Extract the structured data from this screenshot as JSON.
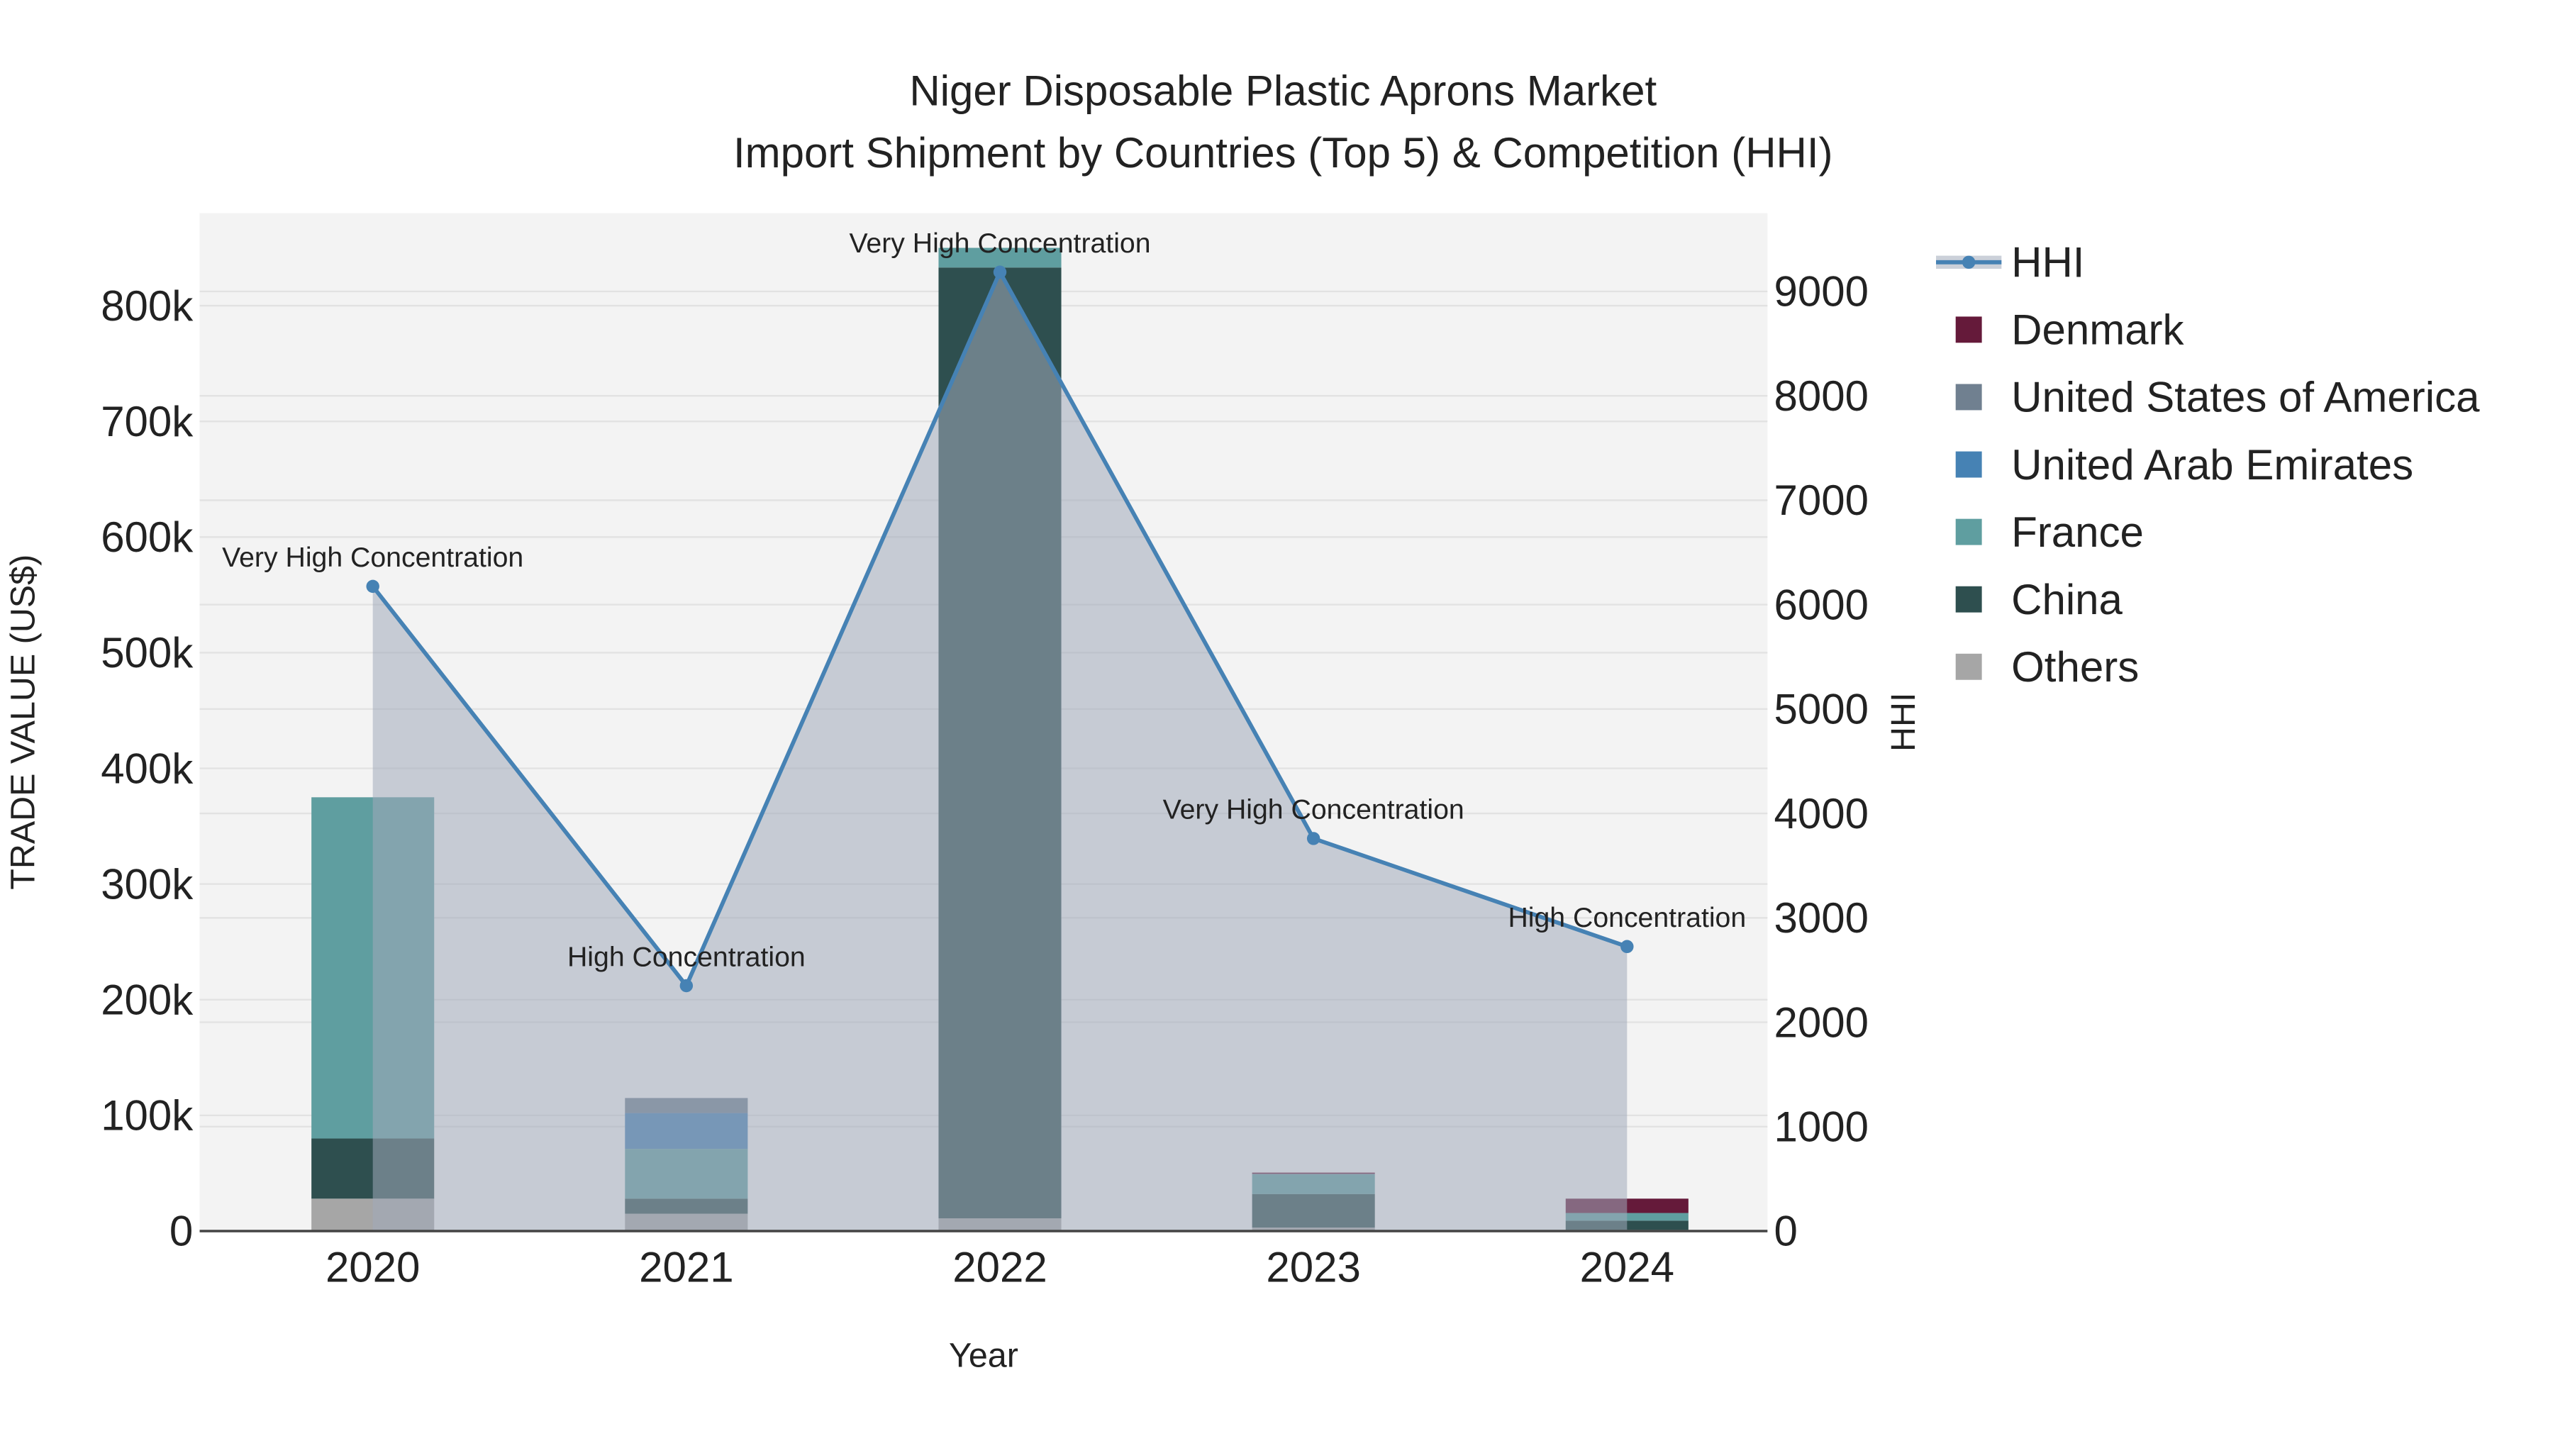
{
  "chart_data": {
    "type": "bar",
    "title": "Niger Disposable Plastic Aprons Market",
    "subtitle": "Import Shipment by Countries (Top 5) & Competition (HHI)",
    "xlabel": "Year",
    "ylabel": "TRADE VALUE (US$)",
    "y2label": "HHI",
    "categories": [
      "2020",
      "2021",
      "2022",
      "2023",
      "2024"
    ],
    "ylim": [
      0,
      880000
    ],
    "y2lim": [
      0,
      9750
    ],
    "yticks": [
      0,
      100000,
      200000,
      300000,
      400000,
      500000,
      600000,
      700000,
      800000
    ],
    "ytick_labels": [
      "0",
      "100k",
      "200k",
      "300k",
      "400k",
      "500k",
      "600k",
      "700k",
      "800k"
    ],
    "y2ticks": [
      0,
      1000,
      2000,
      3000,
      4000,
      5000,
      6000,
      7000,
      8000,
      9000
    ],
    "y2tick_labels": [
      "0",
      "1000",
      "2000",
      "3000",
      "4000",
      "5000",
      "6000",
      "7000",
      "8000",
      "9000"
    ],
    "stacking": "stacked",
    "series": [
      {
        "name": "Others",
        "color": "#a6a6a6",
        "values": [
          28000,
          15000,
          11000,
          3000,
          1000
        ]
      },
      {
        "name": "China",
        "color": "#2e4f4f",
        "values": [
          52000,
          13000,
          822000,
          29000,
          8000
        ]
      },
      {
        "name": "France",
        "color": "#5f9ea0",
        "values": [
          295000,
          43000,
          17000,
          17000,
          6600
        ]
      },
      {
        "name": "United Arab Emirates",
        "color": "#4682b4",
        "values": [
          0,
          31000,
          0,
          0,
          0
        ]
      },
      {
        "name": "United States of America",
        "color": "#708090",
        "values": [
          0,
          13000,
          0,
          500,
          0
        ]
      },
      {
        "name": "Denmark",
        "color": "#651a3a",
        "values": [
          0,
          0,
          0,
          1000,
          12400
        ]
      }
    ],
    "hhi": {
      "name": "HHI",
      "color": "#4682b4",
      "values": [
        6175,
        2350,
        9185,
        3760,
        2725
      ]
    },
    "annotations": [
      "Very High Concentration",
      "High Concentration",
      "Very High Concentration",
      "Very High Concentration",
      "High Concentration"
    ],
    "legend": [
      "HHI",
      "Denmark",
      "United States of America",
      "United Arab Emirates",
      "France",
      "China",
      "Others"
    ],
    "legend_placement": "right",
    "grid": true
  }
}
